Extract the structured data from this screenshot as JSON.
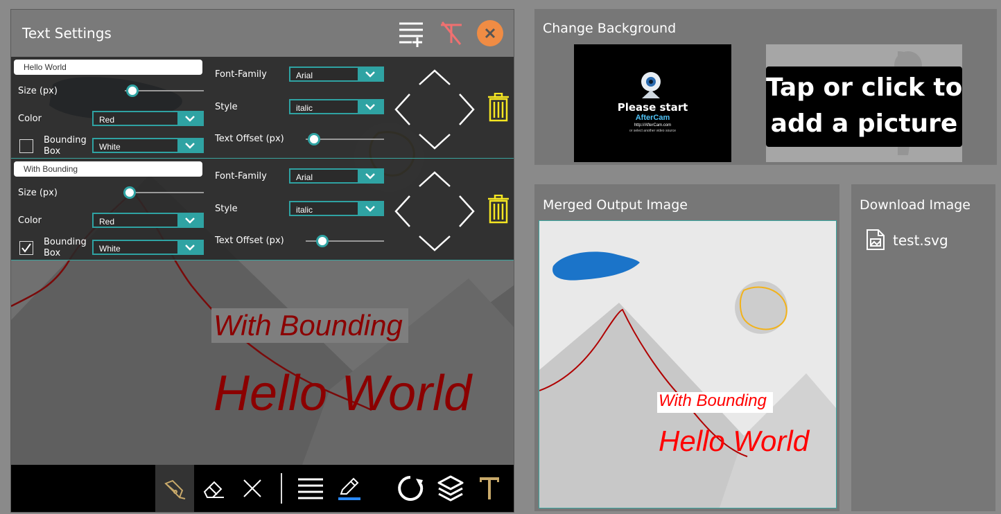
{
  "editor": {
    "title": "Text Settings",
    "rows": [
      {
        "text": "Hello World",
        "size_label": "Size (px)",
        "size_value": 0.1,
        "color_label": "Color",
        "color_value": "Red",
        "bbox_label_1": "Bounding",
        "bbox_label_2": "Box",
        "bbox_checked": false,
        "bbox_color": "White",
        "font_family_label": "Font-Family",
        "font_family_value": "Arial",
        "style_label": "Style",
        "style_value": "italic",
        "offset_label": "Text Offset (px)",
        "offset_value": 0.1
      },
      {
        "text": "With Bounding",
        "size_label": "Size (px)",
        "size_value": 0.05,
        "color_label": "Color",
        "color_value": "Red",
        "bbox_label_1": "Bounding",
        "bbox_label_2": "Box",
        "bbox_checked": true,
        "bbox_color": "White",
        "font_family_label": "Font-Family",
        "font_family_value": "Arial",
        "style_label": "Style",
        "style_value": "italic",
        "offset_label": "Text Offset (px)",
        "offset_value": 0.2
      }
    ],
    "canvas_text_bounding": "With Bounding",
    "canvas_text_hello": "Hello World"
  },
  "background": {
    "title": "Change Background",
    "thumb_line1": "Please start",
    "thumb_line2": "AfterCam",
    "thumb_line3": "http://AfterCam.com",
    "thumb_line4": "or select another video source",
    "add_picture_line1": "Tap or click to",
    "add_picture_line2": "add a picture"
  },
  "merged": {
    "title": "Merged Output Image",
    "text_bounding": "With Bounding",
    "text_hello": "Hello World"
  },
  "download": {
    "title": "Download Image",
    "file_name": "test.svg"
  },
  "colors": {
    "accent": "#2fa3a3",
    "close": "#f08c44",
    "trash": "#f5e622",
    "text_red_dark": "#8b0000",
    "text_red": "#ff0000"
  }
}
